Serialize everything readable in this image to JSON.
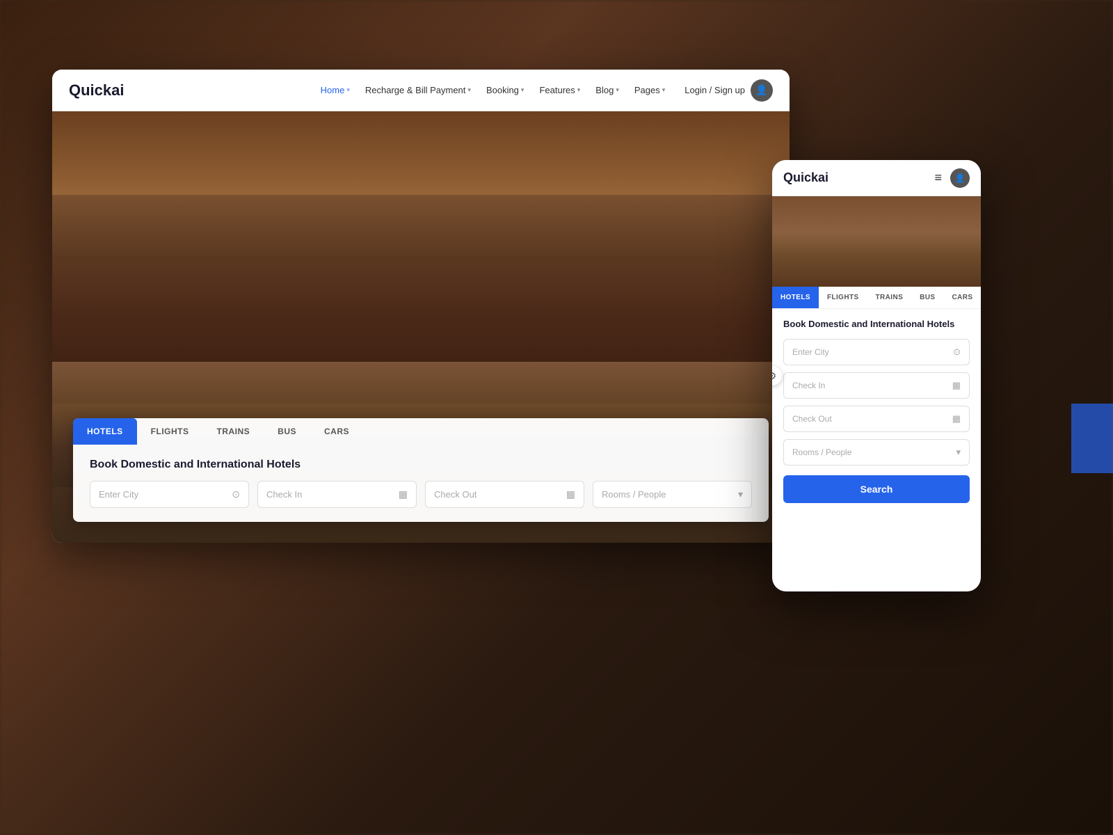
{
  "background": {
    "color": "#3a2010"
  },
  "desktop": {
    "logo": "Quickai",
    "nav": {
      "links": [
        {
          "label": "Home",
          "active": true,
          "has_dropdown": true
        },
        {
          "label": "Recharge & Bill Payment",
          "active": false,
          "has_dropdown": true
        },
        {
          "label": "Booking",
          "active": false,
          "has_dropdown": true
        },
        {
          "label": "Features",
          "active": false,
          "has_dropdown": true
        },
        {
          "label": "Blog",
          "active": false,
          "has_dropdown": true
        },
        {
          "label": "Pages",
          "active": false,
          "has_dropdown": true
        }
      ],
      "login_label": "Login / Sign up"
    },
    "tabs": [
      {
        "label": "HOTELS",
        "active": true
      },
      {
        "label": "FLIGHTS",
        "active": false
      },
      {
        "label": "TRAINS",
        "active": false
      },
      {
        "label": "BUS",
        "active": false
      },
      {
        "label": "CARS",
        "active": false
      }
    ],
    "search": {
      "title": "Book Domestic and International Hotels",
      "fields": [
        {
          "placeholder": "Enter City",
          "icon": "📍"
        },
        {
          "placeholder": "Check In",
          "icon": "📅"
        },
        {
          "placeholder": "Check Out",
          "icon": "📅"
        },
        {
          "placeholder": "Rooms / People",
          "icon": "▼"
        }
      ]
    }
  },
  "mobile": {
    "logo": "Quickai",
    "tabs": [
      {
        "label": "HOTELS",
        "active": true
      },
      {
        "label": "FLIGHTS",
        "active": false
      },
      {
        "label": "TRAINS",
        "active": false
      },
      {
        "label": "BUS",
        "active": false
      },
      {
        "label": "CARS",
        "active": false
      }
    ],
    "search": {
      "title": "Book Domestic and International Hotels",
      "fields": [
        {
          "placeholder": "Enter City",
          "icon": "📍"
        },
        {
          "placeholder": "Check In",
          "icon": "📅"
        },
        {
          "placeholder": "Check Out",
          "icon": "📅"
        },
        {
          "placeholder": "Rooms / People",
          "icon": "▼"
        }
      ],
      "search_button_label": "Search"
    }
  },
  "icons": {
    "hamburger": "≡",
    "gear": "⚙",
    "user": "👤",
    "chevron_down": "▾",
    "location": "⊙",
    "calendar": "▦"
  }
}
